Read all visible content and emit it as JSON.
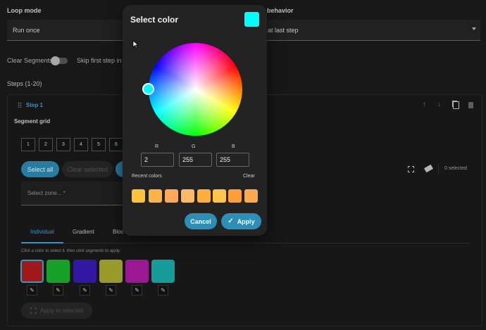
{
  "loop_mode": {
    "label": "Loop mode",
    "value": "Run once"
  },
  "behavior": {
    "label": "behavior",
    "value": "at last step"
  },
  "toggles": {
    "clear_segments": "Clear Segments",
    "skip_first_step": "Skip first step in l"
  },
  "steps_header": "Steps (1-20)",
  "step": {
    "title": "Step 1"
  },
  "segment_grid": {
    "title": "Segment grid",
    "cells": [
      "1",
      "2",
      "3",
      "4",
      "5",
      "6"
    ]
  },
  "selection": {
    "select_all": "Select all",
    "clear_selected": "Clear selected",
    "selected_count": "0 selected"
  },
  "zone": {
    "placeholder": "Select zone... *"
  },
  "tabs": [
    {
      "label": "Individual"
    },
    {
      "label": "Gradient"
    },
    {
      "label": "Bloc"
    }
  ],
  "hint": "Click a color to select it, then click segments to apply.",
  "swatches": [
    "#b81c1c",
    "#1ab82e",
    "#3a1cb8",
    "#adb02f",
    "#b01ca6",
    "#18b2ae"
  ],
  "apply_to_selected": "Apply to selected",
  "dialog": {
    "title": "Select color",
    "preview_color": "#02ffff",
    "rgb": {
      "r_label": "R",
      "g_label": "G",
      "b_label": "B",
      "r": "2",
      "g": "255",
      "b": "255"
    },
    "recent_label": "Recent colors",
    "clear_label": "Clear",
    "recent_colors": [
      "#ffc23a",
      "#ffb347",
      "#ffa75a",
      "#ffb866",
      "#ffad3d",
      "#ffc24a",
      "#ff9e3a",
      "#ffa94f"
    ],
    "cancel": "Cancel",
    "apply": "Apply"
  },
  "colors": {
    "accent": "#2c8fb8",
    "tab_active": "#3fa9e0"
  }
}
